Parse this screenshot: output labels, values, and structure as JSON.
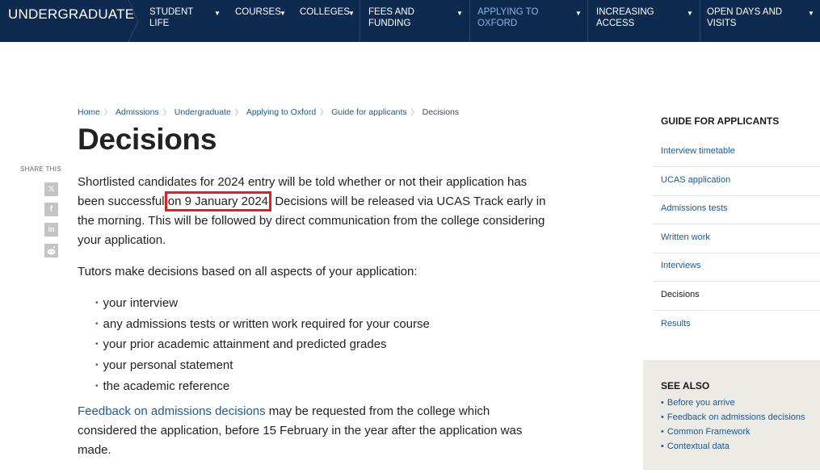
{
  "topnav": {
    "brand": "UNDERGRADUATE",
    "items": [
      {
        "label_line1": "STUDENT",
        "label_line2": "LIFE"
      },
      {
        "label_line1": "COURSES",
        "label_line2": ""
      },
      {
        "label_line1": "COLLEGES",
        "label_line2": ""
      },
      {
        "label_line1": "FEES AND",
        "label_line2": "FUNDING"
      },
      {
        "label_line1": "APPLYING TO",
        "label_line2": "OXFORD"
      },
      {
        "label_line1": "INCREASING",
        "label_line2": "ACCESS"
      },
      {
        "label_line1": "OPEN DAYS AND",
        "label_line2": "VISITS"
      }
    ],
    "active_color": "#8fb3e0",
    "bg_color": "#0f2a4f"
  },
  "breadcrumb": [
    "Home",
    "Admissions",
    "Undergraduate",
    "Applying to Oxford",
    "Guide for applicants",
    "Decisions"
  ],
  "page_title": "Decisions",
  "share": {
    "label": "SHARE THIS",
    "icons": [
      "x-icon",
      "facebook-icon",
      "linkedin-icon",
      "reddit-icon"
    ]
  },
  "content": {
    "p1_before": "Shortlisted candidates for 2024 entry will be told whether or not their application has been successful ",
    "p1_highlight": "on 9 January 2024",
    "p1_after": ". Decisions will be released via UCAS Track early in the morning. This will be followed by direct communication from the college considering your application.",
    "p2": "Tutors make decisions based on all aspects of your application:",
    "bullets": [
      "your interview",
      "any admissions tests or written work required for your course",
      "your prior academic attainment and predicted grades",
      "your personal statement",
      "the academic reference"
    ],
    "p3_link": "Feedback on admissions decisions",
    "p3_after": " may be requested from the college which considered the application, before 15 February in the year after the application was made."
  },
  "sidebar": {
    "title": "GUIDE FOR APPLICANTS",
    "items": [
      "Interview timetable",
      "UCAS application",
      "Admissions tests",
      "Written work",
      "Interviews",
      "Decisions",
      "Results"
    ],
    "current": "Decisions"
  },
  "seealso": {
    "title": "SEE ALSO",
    "items": [
      "Before you arrive",
      "Feedback on admissions decisions",
      "Common Framework",
      "Contextual data"
    ]
  }
}
